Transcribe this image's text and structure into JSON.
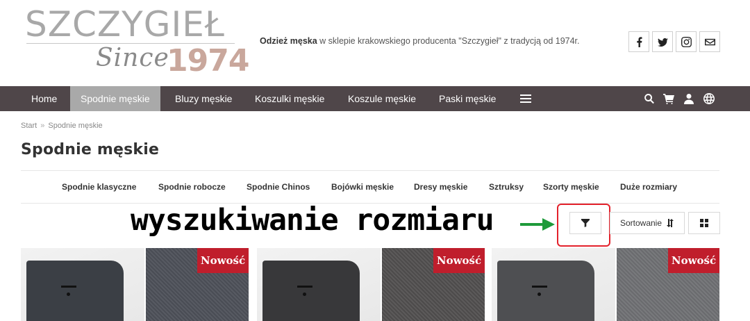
{
  "logo": {
    "name": "SZCZYGIEŁ",
    "since": "Since",
    "year": "1974"
  },
  "tagline": {
    "bold": "Odzież męska",
    "rest": " w sklepie krakowskiego producenta \"Szczygieł\" z tradycją od 1974r."
  },
  "social": [
    "facebook-icon",
    "twitter-icon",
    "instagram-icon",
    "mail-icon"
  ],
  "nav": {
    "items": [
      {
        "label": "Home",
        "active": false
      },
      {
        "label": "Spodnie męskie",
        "active": true
      },
      {
        "label": "Bluzy męskie",
        "active": false
      },
      {
        "label": "Koszulki męskie",
        "active": false
      },
      {
        "label": "Koszule męskie",
        "active": false
      },
      {
        "label": "Paski męskie",
        "active": false
      }
    ],
    "icons": [
      "menu-icon",
      "search-icon",
      "cart-icon",
      "user-icon",
      "globe-icon"
    ]
  },
  "breadcrumb": {
    "home": "Start",
    "separator": "»",
    "current": "Spodnie męskie"
  },
  "page_title": "Spodnie męskie",
  "categories": [
    "Spodnie klasyczne",
    "Spodnie robocze",
    "Spodnie Chinos",
    "Bojówki męskie",
    "Dresy męskie",
    "Sztruksy",
    "Szorty męskie",
    "Duże rozmiary"
  ],
  "annotation": {
    "text": "wyszukiwanie rozmiaru",
    "arrow_color": "#1e9a3a",
    "box_color": "#e3212b"
  },
  "toolbar": {
    "sort_label": "Sortowanie"
  },
  "products": [
    {
      "badge": "Nowość",
      "pants_color": "#3b3f45",
      "fabric_color": "#4a4d55"
    },
    {
      "badge": "Nowość",
      "pants_color": "#38383a",
      "fabric_color": "#4d4b4b"
    },
    {
      "badge": "Nowość",
      "pants_color": "#4e4f52",
      "fabric_color": "#6a6b6e"
    }
  ],
  "colors": {
    "nav_bg": "#4f4649",
    "nav_active": "#a9a9a9",
    "badge": "#c01e2c"
  }
}
